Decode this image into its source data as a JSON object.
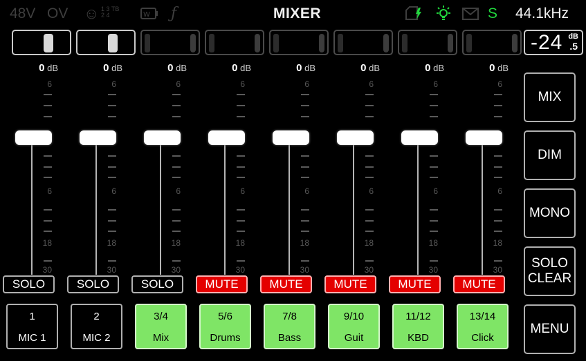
{
  "status": {
    "phantom": "48V",
    "overload": "OV",
    "tb_top": "1 3 TB",
    "tb_bottom": "2 4",
    "f_glyph": "ƒ",
    "title": "MIXER",
    "sync": "S",
    "sample_rate": "44.1kHz",
    "icons": [
      "face-icon",
      "battery-icon",
      "sd-card-icon",
      "bulb-icon",
      "mail-icon"
    ],
    "colors": {
      "green": "#21d63d",
      "dim": "#3e3e3e"
    }
  },
  "master": {
    "level": "-24",
    "level_fraction": ".5",
    "unit": "dB"
  },
  "scale": {
    "top_value": "0",
    "top_unit": "dB",
    "marks": [
      "6",
      "0",
      "6",
      "18",
      "30"
    ]
  },
  "channels": [
    {
      "num": "1",
      "name": "MIC 1",
      "action": "SOLO",
      "gain_db": 0,
      "active": true
    },
    {
      "num": "2",
      "name": "MIC 2",
      "action": "SOLO",
      "gain_db": 0,
      "active": true
    },
    {
      "num": "3/4",
      "name": "Mix",
      "action": "SOLO",
      "gain_db": 0,
      "active": false
    },
    {
      "num": "5/6",
      "name": "Drums",
      "action": "MUTE",
      "gain_db": 0,
      "active": false
    },
    {
      "num": "7/8",
      "name": "Bass",
      "action": "MUTE",
      "gain_db": 0,
      "active": false
    },
    {
      "num": "9/10",
      "name": "Guit",
      "action": "MUTE",
      "gain_db": 0,
      "active": false
    },
    {
      "num": "11/12",
      "name": "KBD",
      "action": "MUTE",
      "gain_db": 0,
      "active": false
    },
    {
      "num": "13/14",
      "name": "Click",
      "action": "MUTE",
      "gain_db": 0,
      "active": false
    }
  ],
  "side": {
    "mix": "MIX",
    "dim": "DIM",
    "mono": "MONO",
    "solo_clear_1": "SOLO",
    "solo_clear_2": "CLEAR",
    "menu": "MENU"
  }
}
